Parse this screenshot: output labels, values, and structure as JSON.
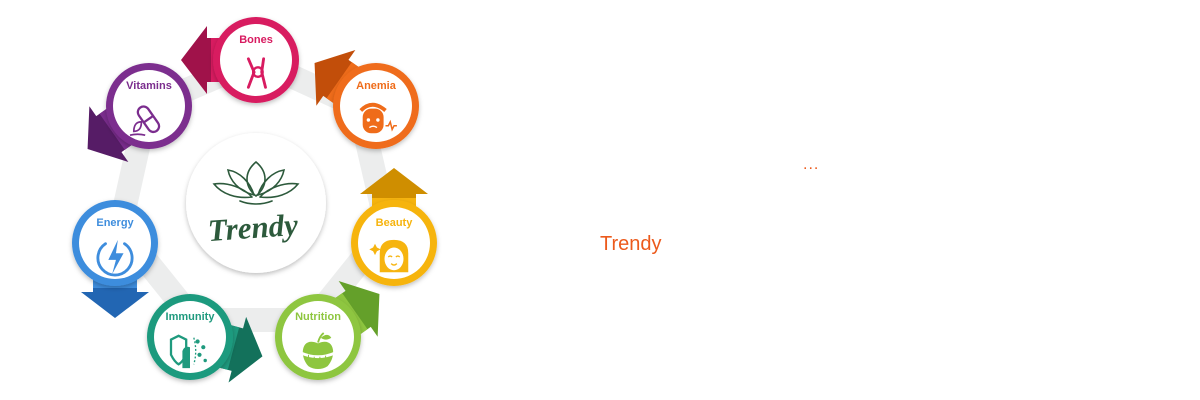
{
  "center_logo": {
    "text": "Trendy",
    "color": "#2d5a3c"
  },
  "nodes": [
    {
      "key": "bones",
      "label": "Bones",
      "icon": "knee-joint-icon",
      "color": "#d81b60",
      "dark": "#a0124a"
    },
    {
      "key": "anemia",
      "label": "Anemia",
      "icon": "anemia-face-icon",
      "color": "#ef6c1a",
      "dark": "#c24e0a"
    },
    {
      "key": "beauty",
      "label": "Beauty",
      "icon": "woman-face-icon",
      "color": "#f6b40f",
      "dark": "#cf8e00"
    },
    {
      "key": "nutrition",
      "label": "Nutrition",
      "icon": "apple-tape-icon",
      "color": "#8ec63f",
      "dark": "#64a02a"
    },
    {
      "key": "immunity",
      "label": "Immunity",
      "icon": "shield-hand-icon",
      "color": "#1f9a7e",
      "dark": "#13715b"
    },
    {
      "key": "energy",
      "label": "Energy",
      "icon": "lightning-bolt-icon",
      "color": "#3e8ddd",
      "dark": "#2266b3"
    },
    {
      "key": "vitamins",
      "label": "Vitamins",
      "icon": "capsule-leaf-icon",
      "color": "#7b2d8e",
      "dark": "#561c66"
    }
  ],
  "side": {
    "ellipsis": "...",
    "brand": "Trendy"
  }
}
